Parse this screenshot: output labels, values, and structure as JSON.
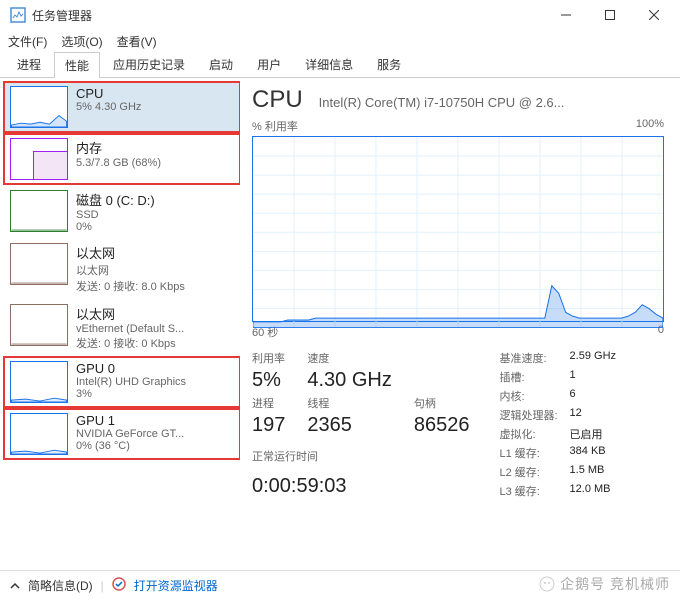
{
  "window": {
    "title": "任务管理器"
  },
  "menus": {
    "file": "文件(F)",
    "options": "选项(O)",
    "view": "查看(V)"
  },
  "tabs": [
    "进程",
    "性能",
    "应用历史记录",
    "启动",
    "用户",
    "详细信息",
    "服务"
  ],
  "active_tab": 1,
  "sidebar": {
    "items": [
      {
        "title": "CPU",
        "sub": "5% 4.30 GHz",
        "selected": true,
        "hl": true,
        "type": "cpu"
      },
      {
        "title": "内存",
        "sub": "5.3/7.8 GB (68%)",
        "hl": true,
        "type": "mem"
      },
      {
        "title": "磁盘 0 (C: D:)",
        "sub": "SSD",
        "sub2": "0%",
        "type": "disk"
      },
      {
        "title": "以太网",
        "sub": "以太网",
        "sub2": "发送: 0 接收: 8.0 Kbps",
        "type": "eth"
      },
      {
        "title": "以太网",
        "sub": "vEthernet (Default S...",
        "sub2": "发送: 0 接收: 0 Kbps",
        "type": "eth"
      },
      {
        "title": "GPU 0",
        "sub": "Intel(R) UHD Graphics",
        "sub2": "3%",
        "hl": true,
        "type": "gpu"
      },
      {
        "title": "GPU 1",
        "sub": "NVIDIA GeForce GT...",
        "sub2": "0% (36 °C)",
        "hl": true,
        "type": "gpu"
      }
    ]
  },
  "main": {
    "title": "CPU",
    "subtitle": "Intel(R) Core(TM) i7-10750H CPU @ 2.6...",
    "graph_label_left": "% 利用率",
    "graph_label_right": "100%",
    "graph_foot_left": "60 秒",
    "graph_foot_right": "0",
    "stats_left": [
      {
        "label": "利用率",
        "value": "5%"
      },
      {
        "label": "速度",
        "value": "4.30 GHz"
      },
      {
        "label": "",
        "value": ""
      },
      {
        "label": "进程",
        "value": "197"
      },
      {
        "label": "线程",
        "value": "2365"
      },
      {
        "label": "句柄",
        "value": "86526"
      }
    ],
    "uptime_label": "正常运行时间",
    "uptime": "0:00:59:03",
    "stats_right": [
      {
        "label": "基准速度:",
        "value": "2.59 GHz"
      },
      {
        "label": "插槽:",
        "value": "1"
      },
      {
        "label": "内核:",
        "value": "6"
      },
      {
        "label": "逻辑处理器:",
        "value": "12"
      },
      {
        "label": "虚拟化:",
        "value": "已启用"
      },
      {
        "label": "L1 缓存:",
        "value": "384 KB"
      },
      {
        "label": "L2 缓存:",
        "value": "1.5 MB"
      },
      {
        "label": "L3 缓存:",
        "value": "12.0 MB"
      }
    ]
  },
  "footer": {
    "brief": "简略信息(D)",
    "resmon": "打开资源监视器"
  },
  "watermark": "企鹅号 竞机械师",
  "chart_data": {
    "type": "line",
    "title": "CPU % 利用率",
    "ylabel": "% 利用率",
    "ylim": [
      0,
      100
    ],
    "x_range_seconds": [
      60,
      0
    ],
    "values_pct": [
      3,
      3,
      3,
      3,
      3,
      4,
      4,
      4,
      4,
      5,
      5,
      5,
      5,
      5,
      5,
      5,
      5,
      5,
      5,
      5,
      5,
      5,
      5,
      5,
      5,
      5,
      5,
      5,
      5,
      5,
      5,
      5,
      5,
      5,
      5,
      5,
      5,
      5,
      5,
      5,
      5,
      5,
      5,
      22,
      18,
      8,
      6,
      5,
      5,
      5,
      5,
      5,
      5,
      5,
      6,
      8,
      12,
      10,
      7,
      5
    ]
  }
}
